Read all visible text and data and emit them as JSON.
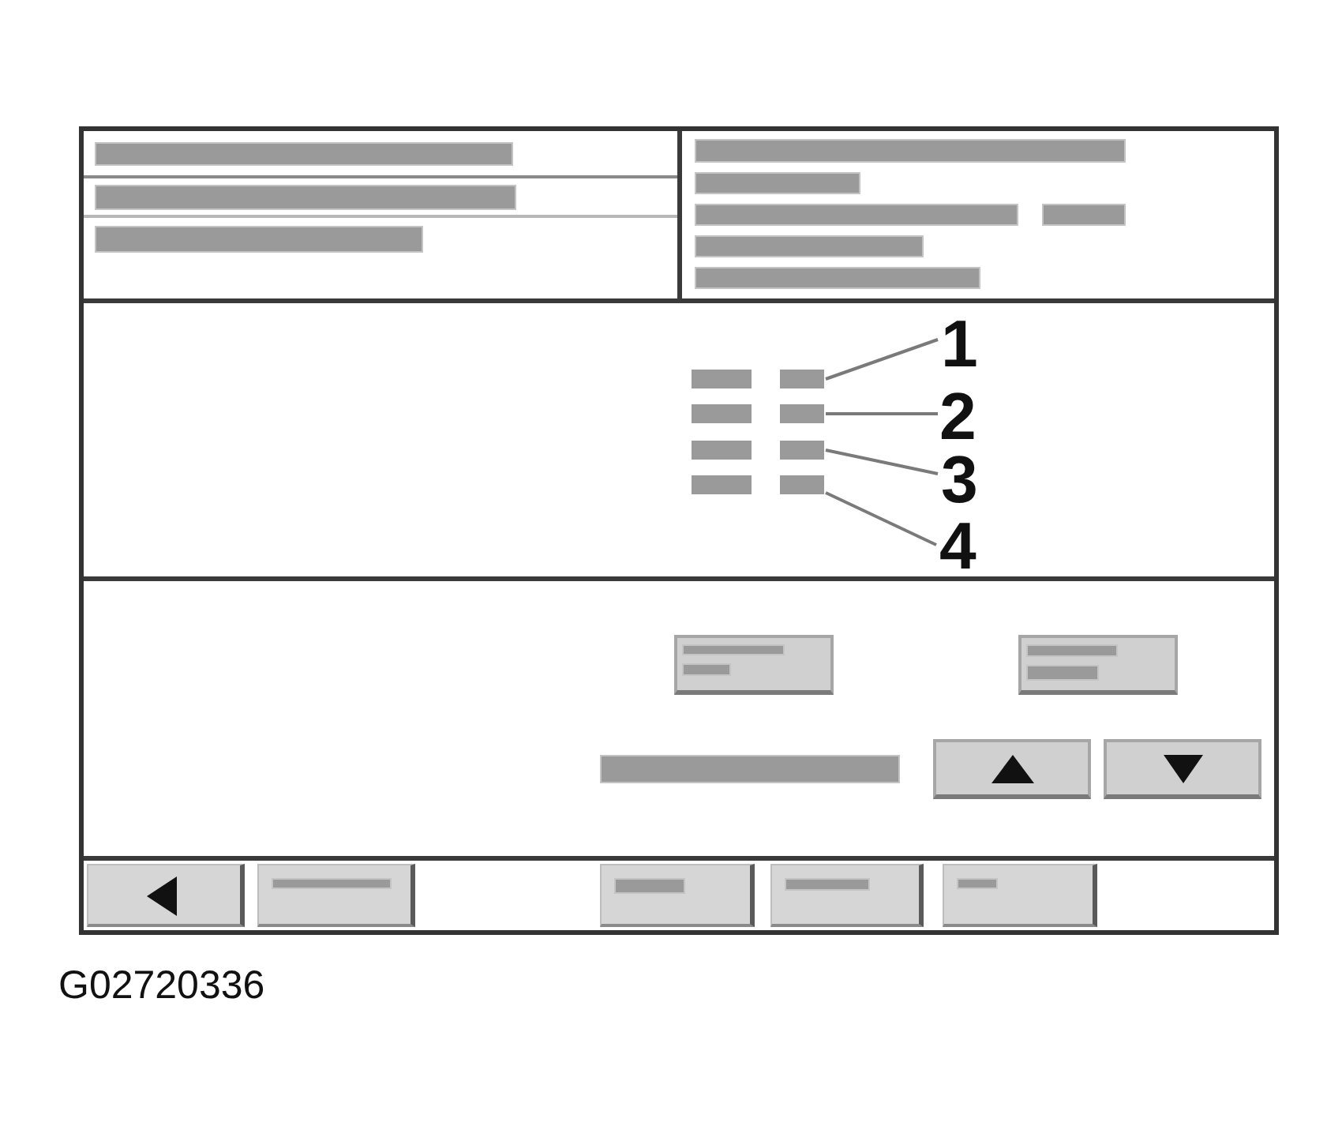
{
  "callouts": [
    "1",
    "2",
    "3",
    "4"
  ],
  "figure_id": "G02720336"
}
